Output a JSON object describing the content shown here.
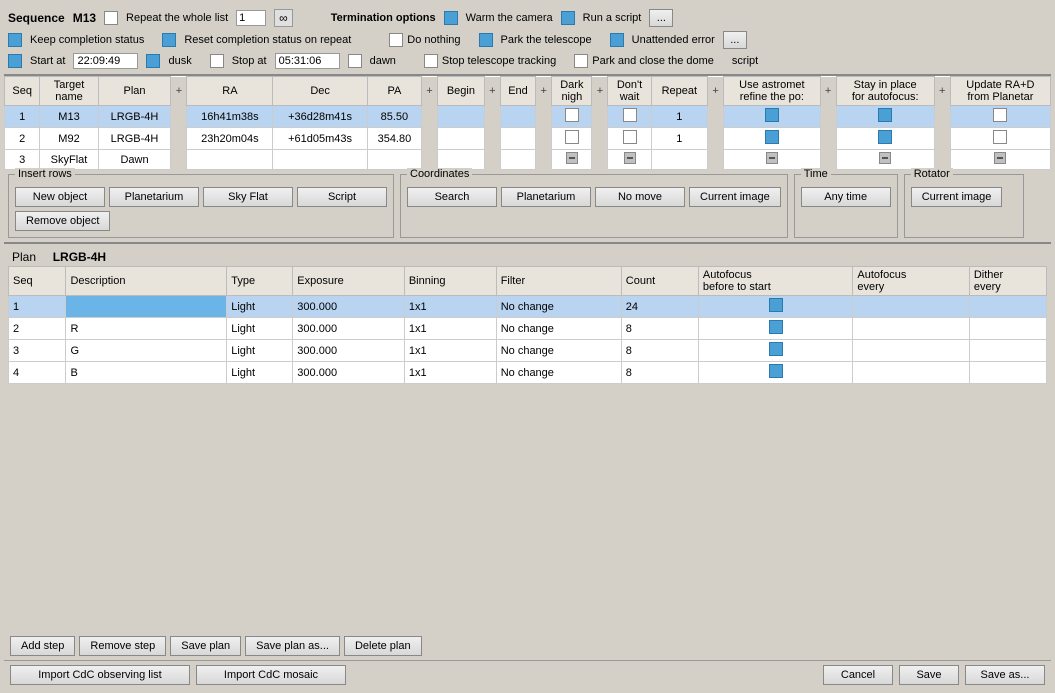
{
  "sequence": {
    "label": "Sequence",
    "name": "M13"
  },
  "top": {
    "repeat_whole_list": "Repeat the whole list",
    "repeat_value": "1",
    "keep_completion": "Keep completion status",
    "reset_completion": "Reset completion status on repeat",
    "start_at": "Start at",
    "start_time": "22:09:49",
    "dusk": "dusk",
    "stop_at": "Stop at",
    "stop_time": "05:31:06",
    "dawn": "dawn",
    "termination": "Termination options",
    "do_nothing": "Do nothing",
    "park_telescope": "Park the telescope",
    "stop_tracking": "Stop telescope tracking",
    "park_close_dome": "Park and close the dome",
    "warm_camera": "Warm the camera",
    "run_script": "Run a script",
    "unattended_error": "Unattended error",
    "script": "script"
  },
  "main_table": {
    "headers": [
      "Seq",
      "Target name",
      "Plan",
      "",
      "RA",
      "Dec",
      "PA",
      "",
      "Begin",
      "",
      "End",
      "",
      "Dark nigh",
      "Don't wait",
      "Repeat",
      "",
      "Use astromet refine the po:",
      "",
      "Stay in place for autofocus:",
      "",
      "Update RA+D from Planetar"
    ],
    "rows": [
      {
        "seq": "1",
        "target": "M13",
        "plan": "LRGB-4H",
        "ra": "16h41m38s",
        "dec": "+36d28m41s",
        "pa": "85.50",
        "selected": true
      },
      {
        "seq": "2",
        "target": "M92",
        "plan": "LRGB-4H",
        "ra": "23h20m04s",
        "dec": "+61d05m43s",
        "pa": "354.80",
        "selected": false
      },
      {
        "seq": "3",
        "target": "SkyFlat",
        "plan": "Dawn",
        "ra": "",
        "dec": "",
        "pa": "",
        "selected": false
      }
    ]
  },
  "insert_rows": {
    "title": "Insert rows",
    "new_object": "New object",
    "planetarium": "Planetarium",
    "sky_flat": "Sky Flat",
    "script": "Script",
    "remove_object": "Remove object"
  },
  "coordinates": {
    "title": "Coordinates",
    "search": "Search",
    "planetarium": "Planetarium",
    "no_move": "No move",
    "current_image": "Current image"
  },
  "time": {
    "title": "Time",
    "any_time": "Any time"
  },
  "rotator": {
    "title": "Rotator",
    "current_image": "Current image"
  },
  "plan": {
    "label": "Plan",
    "name": "LRGB-4H",
    "headers": [
      "Seq",
      "Description",
      "Type",
      "Exposure",
      "Binning",
      "Filter",
      "Count",
      "Autofocus before to start",
      "Autofocus every",
      "Dither every"
    ],
    "rows": [
      {
        "seq": "1",
        "description": "",
        "type": "Light",
        "exposure": "300.000",
        "binning": "1x1",
        "filter": "No change",
        "count": "24",
        "af_before": true,
        "af_every": false,
        "dither": false,
        "selected": true
      },
      {
        "seq": "2",
        "description": "R",
        "type": "Light",
        "exposure": "300.000",
        "binning": "1x1",
        "filter": "No change",
        "count": "8",
        "af_before": true,
        "af_every": false,
        "dither": false,
        "selected": false
      },
      {
        "seq": "3",
        "description": "G",
        "type": "Light",
        "exposure": "300.000",
        "binning": "1x1",
        "filter": "No change",
        "count": "8",
        "af_before": true,
        "af_every": false,
        "dither": false,
        "selected": false
      },
      {
        "seq": "4",
        "description": "B",
        "type": "Light",
        "exposure": "300.000",
        "binning": "1x1",
        "filter": "No change",
        "count": "8",
        "af_before": true,
        "af_every": false,
        "dither": false,
        "selected": false
      }
    ]
  },
  "plan_buttons": {
    "add_step": "Add step",
    "remove_step": "Remove step",
    "save_plan": "Save plan",
    "save_plan_as": "Save plan as...",
    "delete_plan": "Delete plan"
  },
  "bottom_buttons": {
    "import_cdc": "Import CdC observing list",
    "import_mosaic": "Import CdC mosaic",
    "cancel": "Cancel",
    "save": "Save",
    "save_as": "Save as..."
  }
}
